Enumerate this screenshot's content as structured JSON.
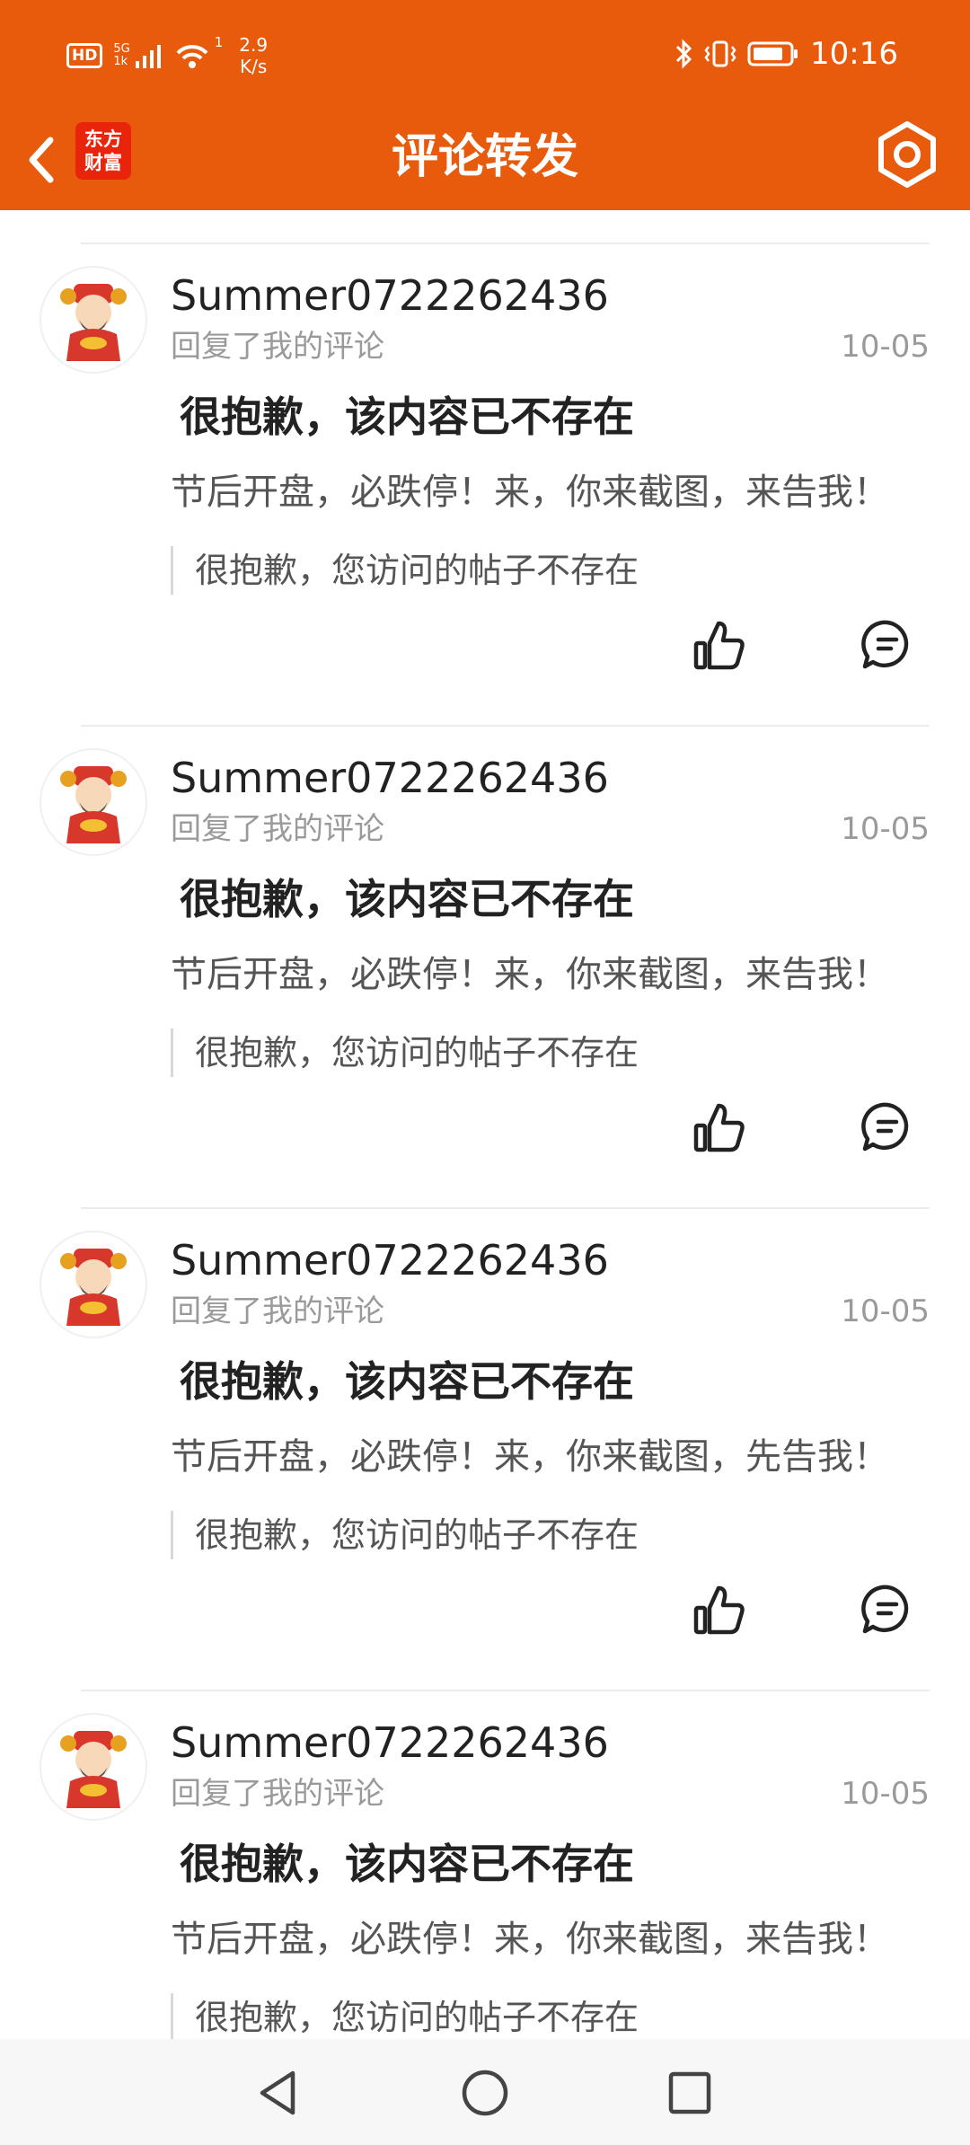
{
  "status_bar": {
    "hd": "HD",
    "network": "5G",
    "network_sub": "1k",
    "wifi_sub": "1",
    "speed_value": "2.9",
    "speed_unit": "K/s",
    "time": "10:16"
  },
  "header": {
    "logo_line1": "东方",
    "logo_line2": "财富",
    "title": "评论转发"
  },
  "items": [
    {
      "username": "Summer0722262436",
      "action": "回复了我的评论",
      "date": "10-05",
      "title": "很抱歉，该内容已不存在",
      "text": "节后开盘，必跌停！来，你来截图，来告我！",
      "quote": "很抱歉，您访问的帖子不存在"
    },
    {
      "username": "Summer0722262436",
      "action": "回复了我的评论",
      "date": "10-05",
      "title": "很抱歉，该内容已不存在",
      "text": "节后开盘，必跌停！来，你来截图，来告我！",
      "quote": "很抱歉，您访问的帖子不存在"
    },
    {
      "username": "Summer0722262436",
      "action": "回复了我的评论",
      "date": "10-05",
      "title": "很抱歉，该内容已不存在",
      "text": "节后开盘，必跌停！来，你来截图，先告我！",
      "quote": "很抱歉，您访问的帖子不存在"
    },
    {
      "username": "Summer0722262436",
      "action": "回复了我的评论",
      "date": "10-05",
      "title": "很抱歉，该内容已不存在",
      "text": "节后开盘，必跌停！来，你来截图，来告我！",
      "quote": "很抱歉，您访问的帖子不存在"
    }
  ],
  "colors": {
    "brand": "#e85a0c",
    "logo": "#e8240a"
  }
}
